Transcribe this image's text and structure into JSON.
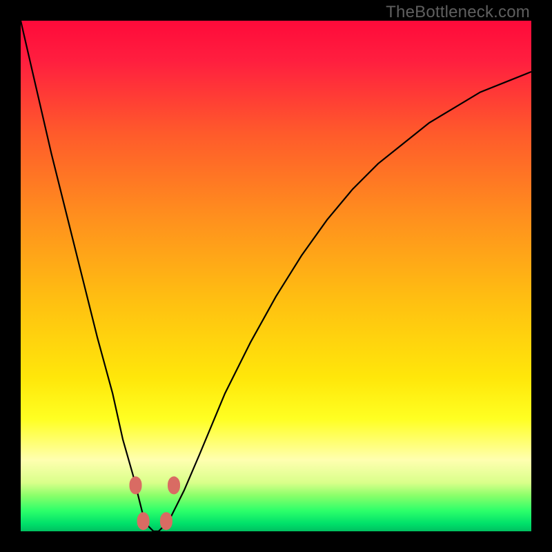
{
  "watermark": "TheBottleneck.com",
  "chart_data": {
    "type": "line",
    "title": "",
    "xlabel": "",
    "ylabel": "",
    "xlim": [
      0,
      100
    ],
    "ylim": [
      0,
      100
    ],
    "grid": false,
    "legend": false,
    "curve": {
      "description": "V-shaped bottleneck curve over rainbow gradient background",
      "x": [
        0,
        3,
        6,
        9,
        12,
        15,
        18,
        20,
        22,
        23,
        24,
        25,
        26,
        27,
        28,
        29,
        30,
        32,
        35,
        40,
        45,
        50,
        55,
        60,
        65,
        70,
        75,
        80,
        85,
        90,
        95,
        100
      ],
      "y": [
        100,
        87,
        74,
        62,
        50,
        38,
        27,
        18,
        11,
        7,
        3,
        1,
        0,
        0,
        1,
        2,
        4,
        8,
        15,
        27,
        37,
        46,
        54,
        61,
        67,
        72,
        76,
        80,
        83,
        86,
        88,
        90
      ]
    },
    "markers": {
      "description": "soft red rounded markers near the bottom of the V",
      "points": [
        {
          "x": 22.5,
          "y": 9
        },
        {
          "x": 24.0,
          "y": 2
        },
        {
          "x": 28.5,
          "y": 2
        },
        {
          "x": 30.0,
          "y": 9
        }
      ],
      "color": "#d96b63"
    },
    "gradient_stops": [
      {
        "offset": 0.0,
        "color": "#ff0a3a"
      },
      {
        "offset": 0.08,
        "color": "#ff1f3f"
      },
      {
        "offset": 0.22,
        "color": "#ff5a2b"
      },
      {
        "offset": 0.38,
        "color": "#ff8e1e"
      },
      {
        "offset": 0.55,
        "color": "#ffc011"
      },
      {
        "offset": 0.7,
        "color": "#ffe70a"
      },
      {
        "offset": 0.78,
        "color": "#ffff22"
      },
      {
        "offset": 0.83,
        "color": "#ffff7a"
      },
      {
        "offset": 0.86,
        "color": "#ffffb0"
      },
      {
        "offset": 0.905,
        "color": "#d9ff8a"
      },
      {
        "offset": 0.93,
        "color": "#8aff6a"
      },
      {
        "offset": 0.96,
        "color": "#2cff6a"
      },
      {
        "offset": 0.985,
        "color": "#00e06a"
      },
      {
        "offset": 1.0,
        "color": "#00c060"
      }
    ]
  }
}
